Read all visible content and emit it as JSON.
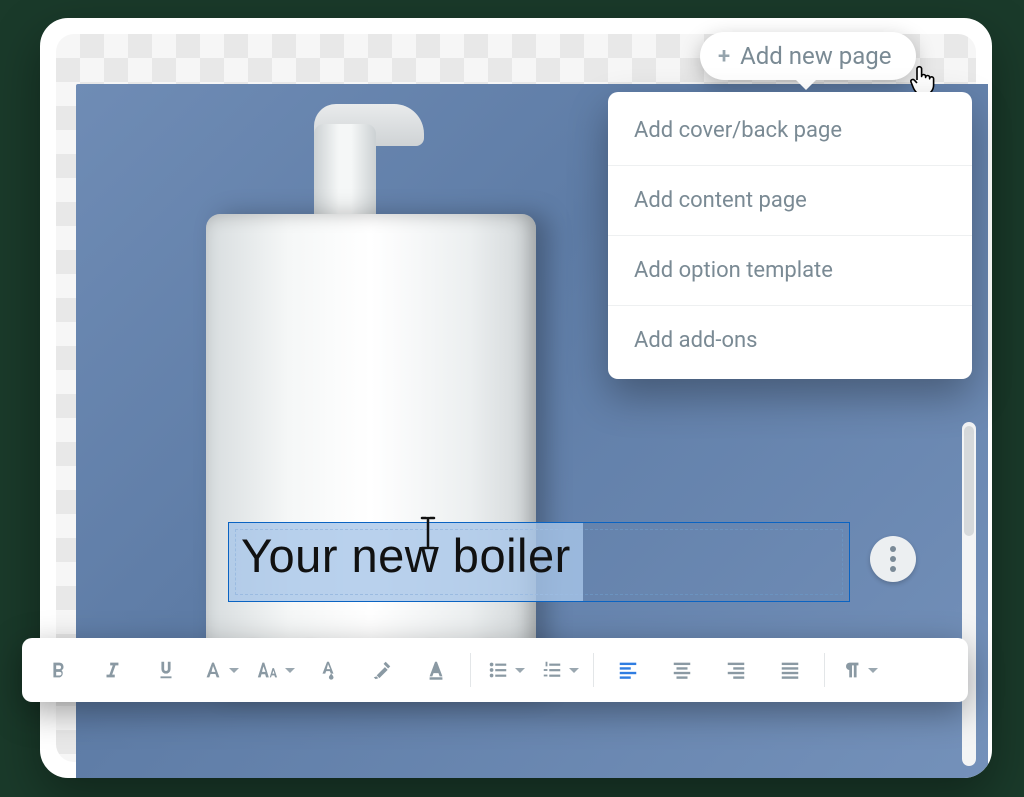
{
  "add_button": {
    "label": "Add new page"
  },
  "menu": {
    "items": [
      {
        "label": "Add cover/back page"
      },
      {
        "label": "Add content page"
      },
      {
        "label": "Add option template"
      },
      {
        "label": "Add add-ons"
      }
    ]
  },
  "textbox": {
    "value": "Your new boiler"
  },
  "toolbar": {
    "bold": "bold-icon",
    "italic": "italic-icon",
    "underline": "underline-icon",
    "font_family": "font-family-icon",
    "font_size": "font-size-icon",
    "font_color": "font-color-icon",
    "highlight": "highlight-icon",
    "clear_format": "clear-format-icon",
    "ul": "bullet-list-icon",
    "ol": "numbered-list-icon",
    "align_left": "align-left-icon",
    "align_center": "align-center-icon",
    "align_right": "align-right-icon",
    "align_justify": "align-justify-icon",
    "paragraph": "paragraph-direction-icon"
  },
  "colors": {
    "accent": "#2f7de1",
    "text_muted": "#7a8a94"
  }
}
